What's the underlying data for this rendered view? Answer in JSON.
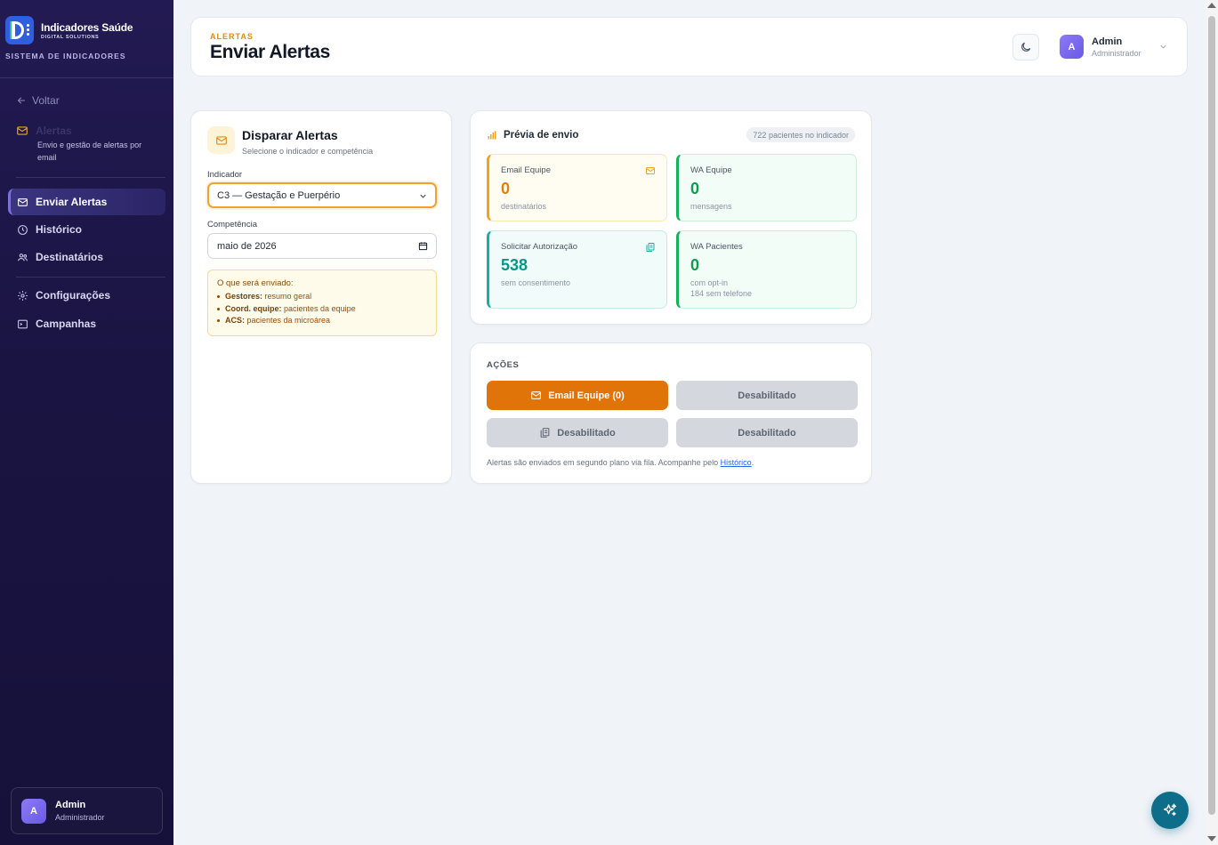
{
  "sidebar": {
    "brand_name": "Indicadores Saúde",
    "brand_sub": "DIGITAL SOLUTIONS",
    "system_label": "SISTEMA DE INDICADORES",
    "back_label": "Voltar",
    "section_title": "Alertas",
    "section_desc": "Envio e gestão de alertas por email",
    "nav": [
      {
        "label": "Enviar Alertas",
        "icon": "mail-icon",
        "active": true
      },
      {
        "label": "Histórico",
        "icon": "clock-icon"
      },
      {
        "label": "Destinatários",
        "icon": "users-icon"
      },
      {
        "label": "Configurações",
        "icon": "gear-icon"
      },
      {
        "label": "Campanhas",
        "icon": "terminal-icon"
      }
    ],
    "user": {
      "initial": "A",
      "name": "Admin",
      "role": "Administrador"
    }
  },
  "header": {
    "kicker": "ALERTAS",
    "title": "Enviar Alertas",
    "user": {
      "initial": "A",
      "name": "Admin",
      "role": "Administrador"
    }
  },
  "dispatch": {
    "title": "Disparar Alertas",
    "subtitle": "Selecione o indicador e competência",
    "indicator_label": "Indicador",
    "indicator_value": "C3 — Gestação e Puerpério",
    "competence_label": "Competência",
    "competence_value": "maio de 2026",
    "info_title": "O que será enviado:",
    "info_items": [
      {
        "role": "Gestores:",
        "text": "resumo geral"
      },
      {
        "role": "Coord. equipe:",
        "text": "pacientes da equipe"
      },
      {
        "role": "ACS:",
        "text": "pacientes da microárea"
      }
    ]
  },
  "preview": {
    "title": "Prévia de envio",
    "badge": "722 pacientes no indicador",
    "stats": [
      {
        "label": "Email Equipe",
        "value": "0",
        "sub": "destinatários",
        "sub2": ""
      },
      {
        "label": "WA Equipe",
        "value": "0",
        "sub": "mensagens",
        "sub2": ""
      },
      {
        "label": "Solicitar Autorização",
        "value": "538",
        "sub": "sem consentimento",
        "sub2": ""
      },
      {
        "label": "WA Pacientes",
        "value": "0",
        "sub": "com opt-in",
        "sub2": "184 sem telefone"
      }
    ]
  },
  "actions": {
    "title": "AÇÕES",
    "primary_label": "Email Equipe (0)",
    "disabled_label_1": "Desabilitado",
    "disabled_label_2": "Desabilitado",
    "disabled_label_3": "Desabilitado",
    "note_text": "Alertas são enviados em segundo plano via fila. Acompanhe pelo ",
    "note_link": "Histórico",
    "note_end": "."
  },
  "colors": {
    "accent": "#e17409",
    "sidebar_bg": "#1a1442",
    "amber": "#f2a31a",
    "green": "#17b15a",
    "teal": "#14b0a0",
    "fab": "#0e6e8a"
  }
}
